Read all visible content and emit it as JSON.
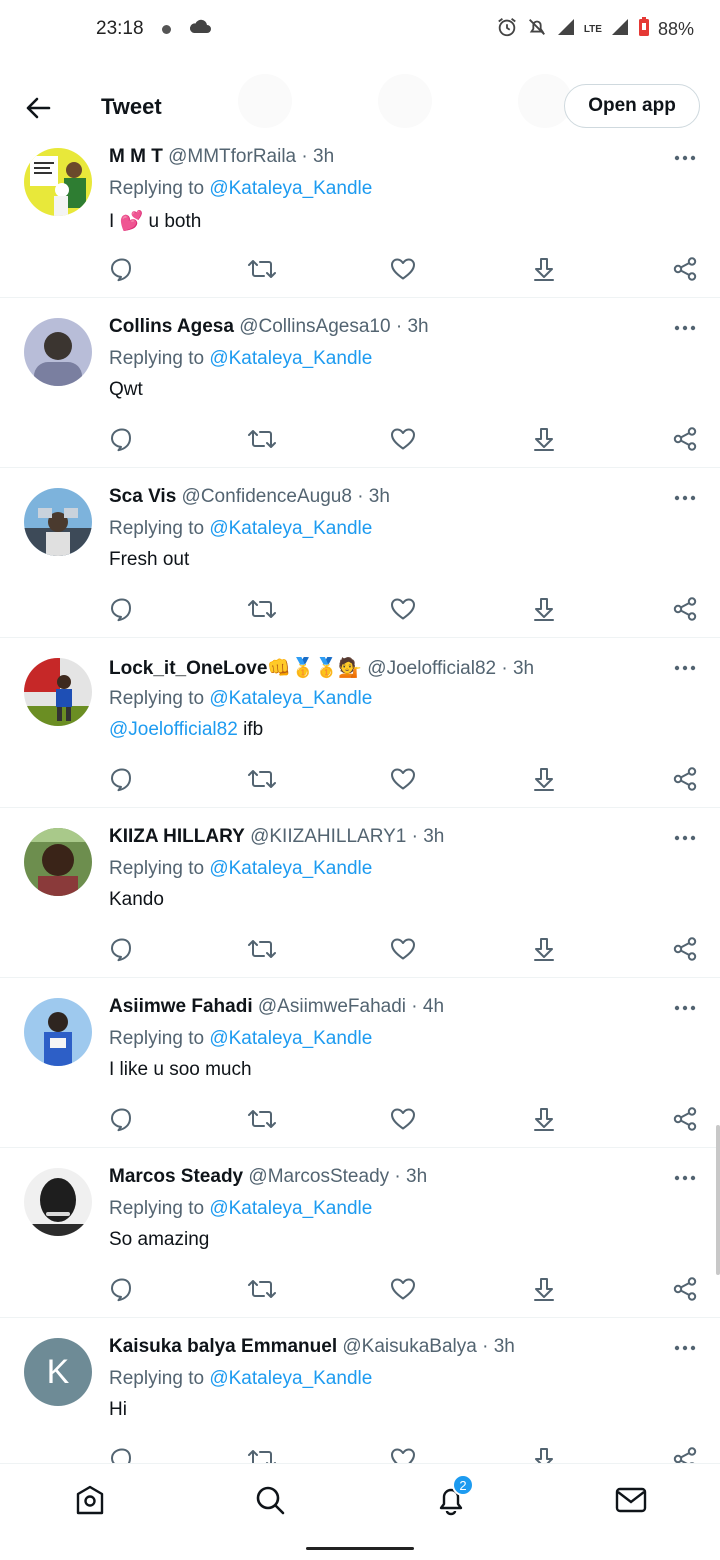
{
  "status_bar": {
    "time": "23:18",
    "network": "LTE",
    "battery": "88%"
  },
  "header": {
    "title": "Tweet",
    "open_app": "Open app"
  },
  "colors": {
    "accent": "#1d9bf0",
    "text": "#0f1419",
    "muted": "#536471",
    "divider": "#eff3f4"
  },
  "tweets": [
    {
      "name": "M M T",
      "handle": "@MMTforRaila",
      "time": "· 3h",
      "replying_prefix": "Replying to ",
      "replying_to": "@Kataleya_Kandle",
      "text_mention": "",
      "text": "I 💕 u both",
      "avatar": "poster"
    },
    {
      "name": "Collins Agesa",
      "handle": "@CollinsAgesa10",
      "time": "· 3h",
      "replying_prefix": "Replying to ",
      "replying_to": "@Kataleya_Kandle",
      "text_mention": "",
      "text": "Qwt",
      "avatar": "photo-gray"
    },
    {
      "name": "Sca Vis",
      "handle": "@ConfidenceAugu8",
      "time": "· 3h",
      "replying_prefix": "Replying to ",
      "replying_to": "@Kataleya_Kandle",
      "text_mention": "",
      "text": "Fresh out",
      "avatar": "photo-blue"
    },
    {
      "name": "Lock_it_OneLove👊🥇🥇💁",
      "handle": "@Joelofficial82",
      "time": "· 3h",
      "replying_prefix": "Replying to ",
      "replying_to": "@Kataleya_Kandle",
      "text_mention": "@Joelofficial82",
      "text": " ifb",
      "avatar": "photo-red"
    },
    {
      "name": "KIIZA HILLARY",
      "handle": "@KIIZAHILLARY1",
      "time": "· 3h",
      "replying_prefix": "Replying to ",
      "replying_to": "@Kataleya_Kandle",
      "text_mention": "",
      "text": "Kando",
      "avatar": "photo-brown"
    },
    {
      "name": "Asiimwe Fahadi",
      "handle": "@AsiimweFahadi",
      "time": "· 4h",
      "replying_prefix": "Replying to ",
      "replying_to": "@Kataleya_Kandle",
      "text_mention": "",
      "text": "I like u soo much",
      "avatar": "photo-sky"
    },
    {
      "name": "Marcos Steady",
      "handle": "@MarcosSteady",
      "time": "· 3h",
      "replying_prefix": "Replying to ",
      "replying_to": "@Kataleya_Kandle",
      "text_mention": "",
      "text": "So amazing",
      "avatar": "photo-bw"
    },
    {
      "name": "Kaisuka balya Emmanuel",
      "handle": "@KaisukaBalya",
      "time": "· 3h",
      "replying_prefix": "Replying to ",
      "replying_to": "@Kataleya_Kandle",
      "text_mention": "",
      "text": "Hi",
      "avatar": "letter",
      "avatar_letter": "K"
    }
  ],
  "icons": {
    "actions": [
      "reply-icon",
      "retweet-icon",
      "like-icon",
      "download-icon",
      "share-icon"
    ],
    "nav": [
      "home-icon",
      "search-icon",
      "notifications-icon",
      "messages-icon"
    ]
  },
  "bottom_nav": {
    "notifications_badge": "2"
  }
}
